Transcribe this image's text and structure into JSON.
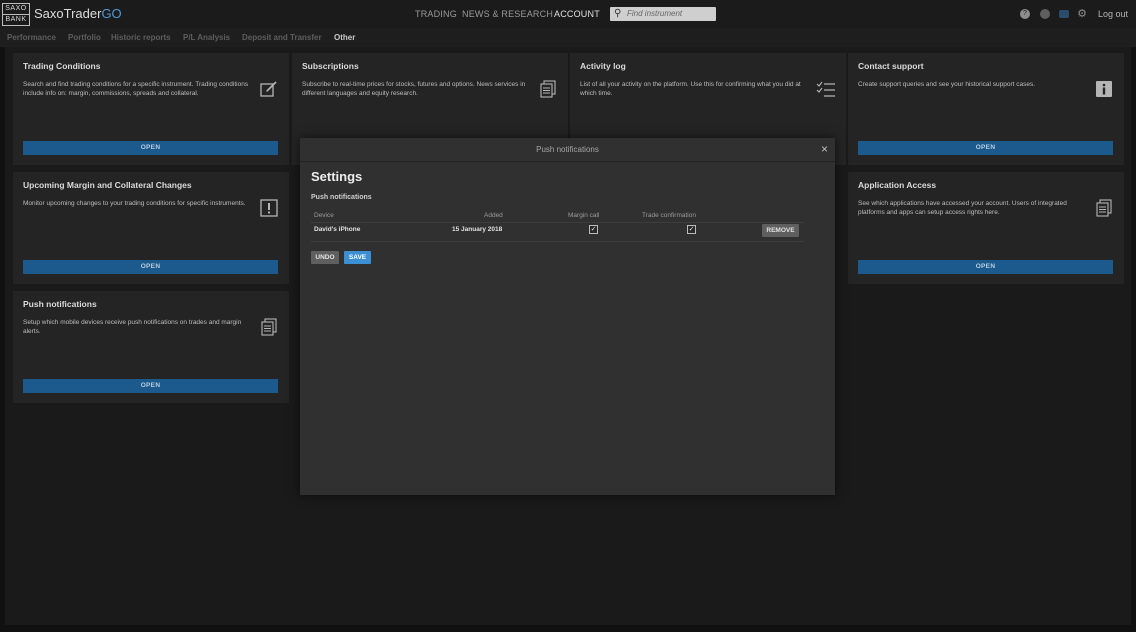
{
  "logo": {
    "line1": "SAXO",
    "line2": "BANK"
  },
  "brand": {
    "name": "SaxoTrader",
    "suffix": "GO"
  },
  "top_nav": [
    {
      "label": "TRADING",
      "active": false
    },
    {
      "label": "NEWS & RESEARCH",
      "active": false
    },
    {
      "label": "ACCOUNT",
      "active": true
    }
  ],
  "search": {
    "placeholder": "Find instrument"
  },
  "header_icons": [
    "help-icon",
    "contrast-icon",
    "chat-icon",
    "settings-icon"
  ],
  "logout_label": "Log out",
  "sub_nav": [
    {
      "label": "Performance",
      "active": false
    },
    {
      "label": "Portfolio",
      "active": false
    },
    {
      "label": "Historic reports",
      "active": false
    },
    {
      "label": "P/L Analysis",
      "active": false
    },
    {
      "label": "Deposit and Transfer",
      "active": false
    },
    {
      "label": "Other",
      "active": true
    }
  ],
  "cards": [
    {
      "title": "Trading Conditions",
      "description": "Search and find trading conditions for a specific instrument. Trading conditions include info on: margin, commissions, spreads and collateral.",
      "button": "OPEN",
      "icon": "edit-icon"
    },
    {
      "title": "Subscriptions",
      "description": "Subscribe to real-time prices for stocks, futures and options. News services in different languages and equity research.",
      "button": "",
      "icon": "documents-icon"
    },
    {
      "title": "Activity log",
      "description": "List of all your activity on the platform. Use this for confirming what you did at which time.",
      "button": "",
      "icon": "checklist-icon"
    },
    {
      "title": "Contact support",
      "description": "Create support queries and see your historical support cases.",
      "button": "OPEN",
      "icon": "info-icon"
    },
    {
      "title": "Upcoming Margin and Collateral Changes",
      "description": "Monitor upcoming changes to your trading conditions for specific instruments.",
      "button": "OPEN",
      "icon": "alert-icon"
    },
    {
      "title": "Application Access",
      "description": "See which applications have accessed your account. Users of integrated platforms and apps can setup access rights here.",
      "button": "OPEN",
      "icon": "documents-icon"
    },
    {
      "title": "Push notifications",
      "description": "Setup which mobile devices receive push notifications on trades and margin alerts.",
      "button": "OPEN",
      "icon": "documents-icon"
    }
  ],
  "modal": {
    "header": "Push notifications",
    "close": "×",
    "title": "Settings",
    "section_label": "Push notifications",
    "columns": {
      "device": "Device",
      "added": "Added",
      "margin_call": "Margin call",
      "trade_confirmation": "Trade confirmation"
    },
    "rows": [
      {
        "device": "David's iPhone",
        "added": "15 January 2018",
        "margin_call": true,
        "trade_confirmation": true,
        "action": "REMOVE"
      }
    ],
    "undo_label": "UNDO",
    "save_label": "SAVE"
  },
  "colors": {
    "accent": "#3d8fd4",
    "card_button": "#1c5a8e",
    "brand_go": "#4f9ad7"
  }
}
